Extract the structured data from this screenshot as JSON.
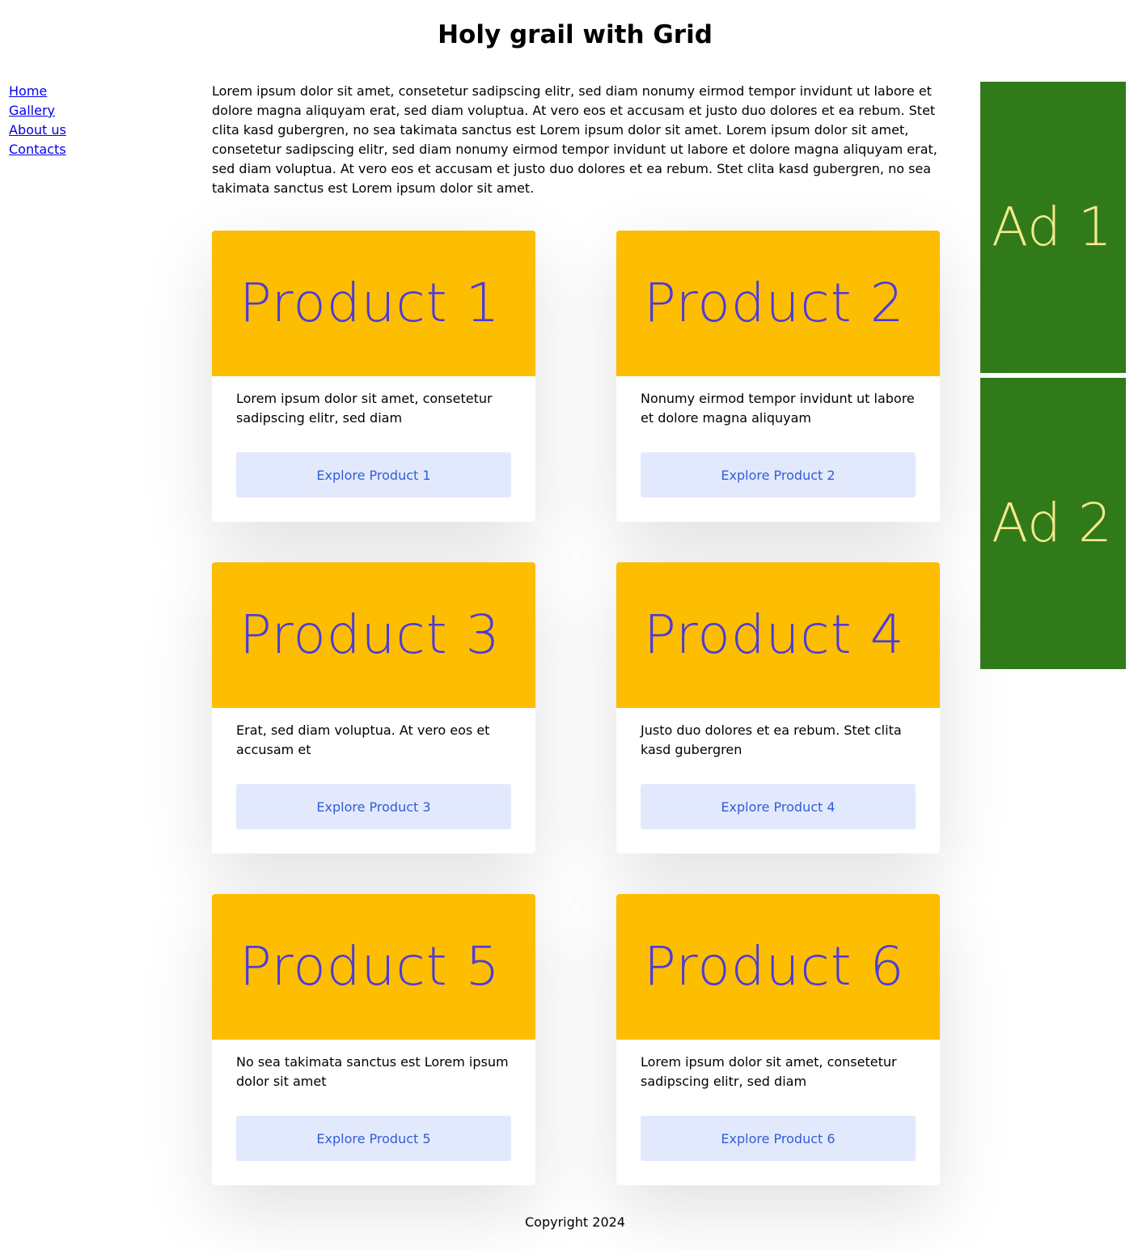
{
  "header": {
    "title": "Holy grail with Grid"
  },
  "nav": {
    "items": [
      {
        "label": "Home"
      },
      {
        "label": "Gallery"
      },
      {
        "label": "About us"
      },
      {
        "label": "Contacts"
      }
    ]
  },
  "main": {
    "intro": "Lorem ipsum dolor sit amet, consetetur sadipscing elitr, sed diam nonumy eirmod tempor invidunt ut labore et dolore magna aliquyam erat, sed diam voluptua. At vero eos et accusam et justo duo dolores et ea rebum. Stet clita kasd gubergren, no sea takimata sanctus est Lorem ipsum dolor sit amet. Lorem ipsum dolor sit amet, consetetur sadipscing elitr, sed diam nonumy eirmod tempor invidunt ut labore et dolore magna aliquyam erat, sed diam voluptua. At vero eos et accusam et justo duo dolores et ea rebum. Stet clita kasd gubergren, no sea takimata sanctus est Lorem ipsum dolor sit amet.",
    "products": [
      {
        "title": "Product 1",
        "description": "Lorem ipsum dolor sit amet, consetetur sadipscing elitr, sed diam",
        "button": "Explore Product 1"
      },
      {
        "title": "Product 2",
        "description": "Nonumy eirmod tempor invidunt ut labore et dolore magna aliquyam",
        "button": "Explore Product 2"
      },
      {
        "title": "Product 3",
        "description": "Erat, sed diam voluptua. At vero eos et accusam et",
        "button": "Explore Product 3"
      },
      {
        "title": "Product 4",
        "description": "Justo duo dolores et ea rebum. Stet clita kasd gubergren",
        "button": "Explore Product 4"
      },
      {
        "title": "Product 5",
        "description": "No sea takimata sanctus est Lorem ipsum dolor sit amet",
        "button": "Explore Product 5"
      },
      {
        "title": "Product 6",
        "description": "Lorem ipsum dolor sit amet, consetetur sadipscing elitr, sed diam",
        "button": "Explore Product 6"
      }
    ]
  },
  "ads": [
    {
      "label": "Ad 1"
    },
    {
      "label": "Ad 2"
    }
  ],
  "footer": {
    "text": "Copyright 2024"
  },
  "colors": {
    "card_hero_bg": "#fdbd00",
    "card_hero_text": "#4a3bdb",
    "button_bg": "#e3e9fd",
    "button_text": "#2f5fd5",
    "ad_bg": "#317a19",
    "ad_text": "#f4e98e",
    "link": "#0000ee"
  }
}
